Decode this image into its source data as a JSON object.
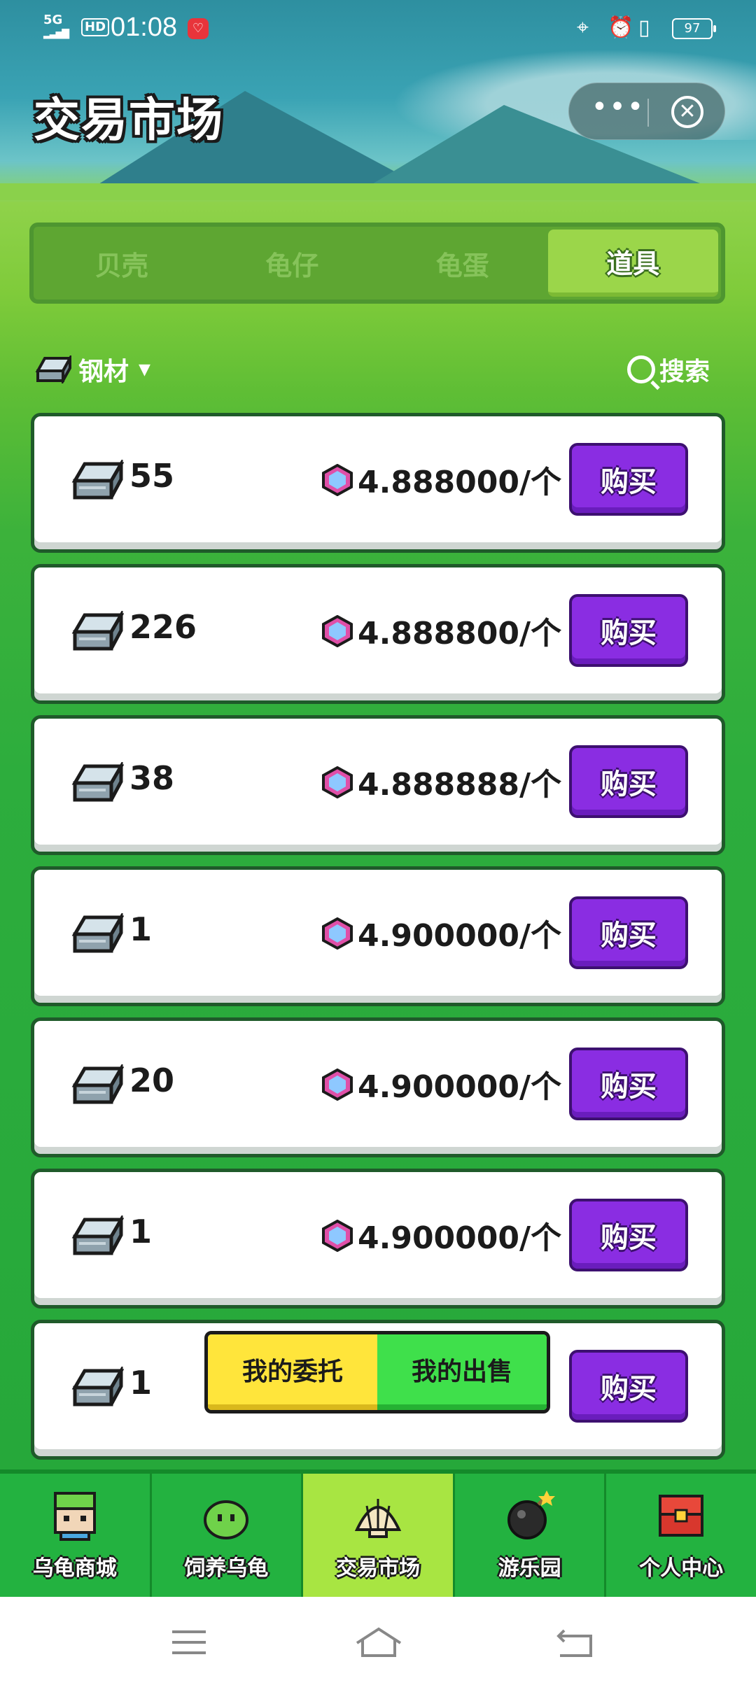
{
  "status_bar": {
    "network": "5G",
    "hd": "HD",
    "time": "01:08",
    "battery": "97"
  },
  "header": {
    "title": "交易市场",
    "more_label": "•••",
    "close_label": "✕"
  },
  "tabs": [
    {
      "label": "贝壳",
      "active": false
    },
    {
      "label": "龟仔",
      "active": false
    },
    {
      "label": "龟蛋",
      "active": false
    },
    {
      "label": "道具",
      "active": true
    }
  ],
  "filter": {
    "selected": "钢材",
    "search_label": "搜索"
  },
  "listings": [
    {
      "quantity": "55",
      "price": "4.888000/个",
      "button": "购买"
    },
    {
      "quantity": "226",
      "price": "4.888800/个",
      "button": "购买"
    },
    {
      "quantity": "38",
      "price": "4.888888/个",
      "button": "购买"
    },
    {
      "quantity": "1",
      "price": "4.900000/个",
      "button": "购买"
    },
    {
      "quantity": "20",
      "price": "4.900000/个",
      "button": "购买"
    },
    {
      "quantity": "1",
      "price": "4.900000/个",
      "button": "购买"
    },
    {
      "quantity": "1",
      "price": "",
      "button": "购买"
    }
  ],
  "toggle": {
    "my_orders": "我的委托",
    "my_sales": "我的出售"
  },
  "bottom_nav": [
    {
      "label": "乌龟商城",
      "icon": "pixel-head-icon"
    },
    {
      "label": "饲养乌龟",
      "icon": "slime-icon"
    },
    {
      "label": "交易市场",
      "icon": "shell-icon"
    },
    {
      "label": "游乐园",
      "icon": "bomb-icon"
    },
    {
      "label": "个人中心",
      "icon": "chest-icon"
    }
  ],
  "colors": {
    "buy_button": "#8a2de2",
    "active_tab": "#9bd64a",
    "nav_active": "#a8e542",
    "toggle_left": "#ffe53b",
    "toggle_right": "#3fe04b"
  }
}
